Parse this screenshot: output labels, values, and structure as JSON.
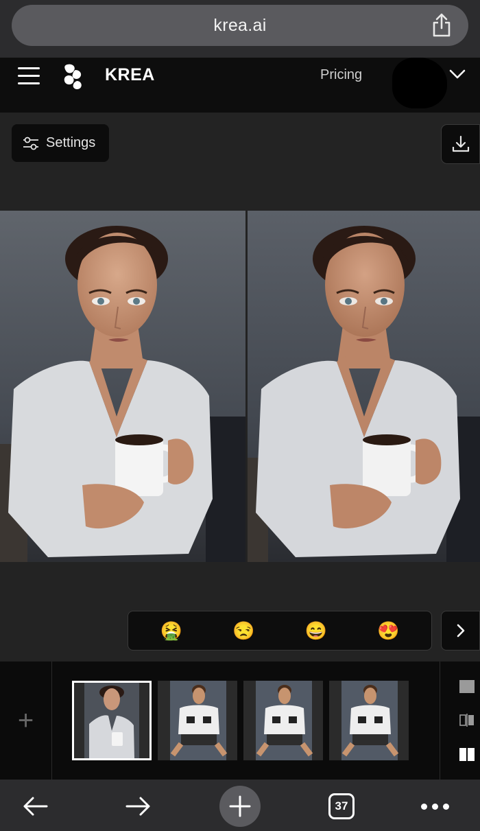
{
  "browser": {
    "url": "krea.ai",
    "tab_count": "37",
    "icons": [
      "share-icon",
      "back-arrow-icon",
      "forward-arrow-icon",
      "new-tab-plus-icon",
      "tabs-icon",
      "more-dots-icon"
    ]
  },
  "header": {
    "brand": "KREA",
    "pricing_label": "Pricing"
  },
  "toolbar": {
    "settings_label": "Settings"
  },
  "reactions": {
    "items": [
      {
        "name": "disgust",
        "glyph": "🤮"
      },
      {
        "name": "unamused",
        "glyph": "😒"
      },
      {
        "name": "grin",
        "glyph": "😄"
      },
      {
        "name": "love",
        "glyph": "😍"
      }
    ]
  },
  "thumbnails": {
    "selected_index": 0,
    "items": [
      {
        "subject": "woman-with-coffee-mug"
      },
      {
        "subject": "man-with-dumbbells"
      },
      {
        "subject": "man-with-dumbbells"
      },
      {
        "subject": "man-with-dumbbells"
      }
    ]
  },
  "layout_options": [
    "single-view",
    "split-compare-view",
    "side-by-side-view"
  ],
  "colors": {
    "background": "#232323",
    "header": "#0d0d0d",
    "browser_chrome": "#2c2c2e",
    "url_pill": "#5a5a5e"
  }
}
